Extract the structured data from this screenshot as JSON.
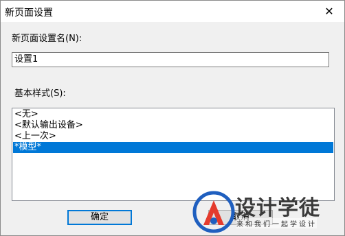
{
  "window": {
    "title": "新页面设置",
    "close_symbol": "✕"
  },
  "form": {
    "name_label": "新页面设置名(N):",
    "name_value": "设置1",
    "style_label": "基本样式(S):",
    "styles": [
      {
        "label": "<无>",
        "selected": false
      },
      {
        "label": "<默认输出设备>",
        "selected": false
      },
      {
        "label": "<上一次>",
        "selected": false
      },
      {
        "label": "*模型*",
        "selected": true
      }
    ]
  },
  "buttons": {
    "ok": "确定",
    "cancel": "取消"
  },
  "watermark": {
    "title": "设计学徒",
    "subtitle": "来和我们一起学设计",
    "colors": {
      "blue": "#1f5fbf",
      "red": "#e43b2d",
      "gray": "#3a3a3a"
    }
  },
  "colors": {
    "selection": "#0078d7"
  }
}
